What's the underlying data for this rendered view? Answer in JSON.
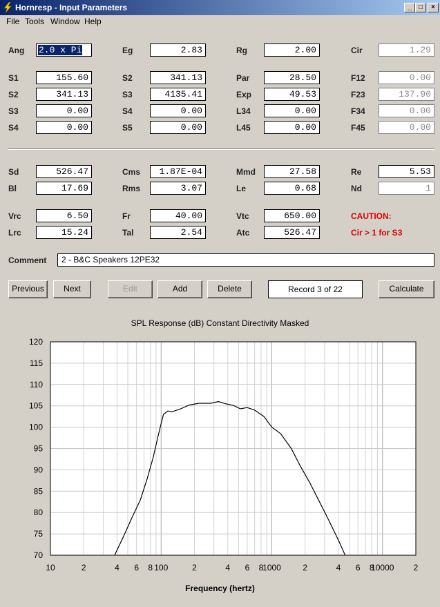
{
  "window": {
    "title": "Hornresp - Input Parameters",
    "min": "_",
    "max": "□",
    "close": "×"
  },
  "menu": [
    "File",
    "Tools",
    "Window",
    "Help"
  ],
  "params": {
    "Ang": "2.0 x Pi",
    "Eg": "2.83",
    "Rg": "2.00",
    "Cir": "1.29",
    "S1": "155.60",
    "S2a": "341.13",
    "Par": "28.50",
    "F12": "0.00",
    "S2b": "341.13",
    "S3a": "4135.41",
    "Exp": "49.53",
    "F23": "137.90",
    "S3b": "0.00",
    "S4a": "0.00",
    "L34": "0.00",
    "F34": "0.00",
    "S4b": "0.00",
    "S5": "0.00",
    "L45": "0.00",
    "F45": "0.00",
    "Sd": "526.47",
    "Cms": "1.87E-04",
    "Mmd": "27.58",
    "Re": "5.53",
    "Bl": "17.69",
    "Rms": "3.07",
    "Le": "0.68",
    "Nd": "1",
    "Vrc": "6.50",
    "Fr": "40.00",
    "Vtc": "650.00",
    "Lrc": "15.24",
    "Tal": "2.54",
    "Atc": "526.47"
  },
  "labels": {
    "Ang": "Ang",
    "Eg": "Eg",
    "Rg": "Rg",
    "Cir": "Cir",
    "S1": "S1",
    "S2a": "S2",
    "Par": "Par",
    "F12": "F12",
    "S2b": "S2",
    "S3a": "S3",
    "Exp": "Exp",
    "F23": "F23",
    "S3b": "S3",
    "S4a": "S4",
    "L34": "L34",
    "F34": "F34",
    "S4b": "S4",
    "S5": "S5",
    "L45": "L45",
    "F45": "F45",
    "Sd": "Sd",
    "Cms": "Cms",
    "Mmd": "Mmd",
    "Re": "Re",
    "Bl": "Bl",
    "Rms": "Rms",
    "Le": "Le",
    "Nd": "Nd",
    "Vrc": "Vrc",
    "Fr": "Fr",
    "Vtc": "Vtc",
    "Lrc": "Lrc",
    "Tal": "Tal",
    "Atc": "Atc",
    "Comment": "Comment"
  },
  "caution": {
    "title": "CAUTION:",
    "message": "Cir > 1 for S3"
  },
  "comment": "2 - B&C Speakers 12PE32",
  "buttons": {
    "previous": "Previous",
    "next": "Next",
    "edit": "Edit",
    "add": "Add",
    "delete": "Delete",
    "calculate": "Calculate"
  },
  "record": "Record 3 of 22",
  "chart_title": "SPL Response (dB)   Constant Directivity   Masked",
  "chart_data": {
    "type": "line",
    "title": "SPL Response (dB)   Constant Directivity   Masked",
    "xlabel": "Frequency (hertz)",
    "ylabel": "",
    "xscale": "log",
    "xlim": [
      10,
      20000
    ],
    "ylim": [
      70,
      120
    ],
    "yticks": [
      70,
      75,
      80,
      85,
      90,
      95,
      100,
      105,
      110,
      115,
      120
    ],
    "xtick_labels": [
      {
        "v": 10,
        "t": "10"
      },
      {
        "v": 20,
        "t": "2"
      },
      {
        "v": 40,
        "t": "4"
      },
      {
        "v": 60,
        "t": "6"
      },
      {
        "v": 80,
        "t": "8"
      },
      {
        "v": 100,
        "t": "100"
      },
      {
        "v": 200,
        "t": "2"
      },
      {
        "v": 400,
        "t": "4"
      },
      {
        "v": 600,
        "t": "6"
      },
      {
        "v": 800,
        "t": "8"
      },
      {
        "v": 1000,
        "t": "1000"
      },
      {
        "v": 2000,
        "t": "2"
      },
      {
        "v": 4000,
        "t": "4"
      },
      {
        "v": 6000,
        "t": "6"
      },
      {
        "v": 8000,
        "t": "8"
      },
      {
        "v": 10000,
        "t": "10000"
      },
      {
        "v": 20000,
        "t": "2"
      }
    ],
    "grid": true,
    "series": [
      {
        "x": [
          38,
          45,
          55,
          65,
          75,
          85,
          95,
          105,
          115,
          125,
          150,
          180,
          220,
          280,
          330,
          380,
          450,
          520,
          600,
          700,
          850,
          1000,
          1200,
          1500,
          1800,
          2200,
          2700,
          3300,
          4000,
          4600
        ],
        "y": [
          70,
          74,
          79,
          83,
          88,
          93,
          98.5,
          103,
          103.8,
          103.6,
          104.3,
          105.2,
          105.6,
          105.6,
          106,
          105.5,
          105.1,
          104.3,
          104.6,
          104,
          102.5,
          100,
          98.5,
          95,
          91,
          87,
          82.5,
          78,
          73.5,
          70
        ]
      }
    ]
  }
}
